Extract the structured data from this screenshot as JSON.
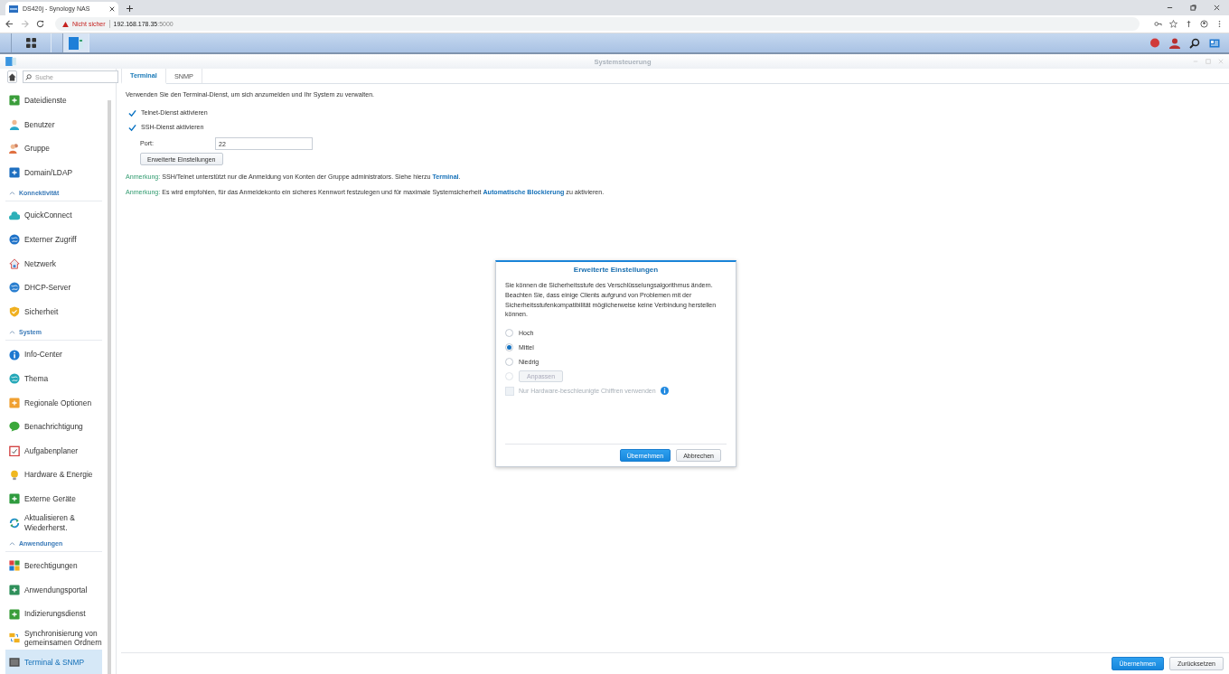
{
  "browser": {
    "tab_title": "DS420j - Synology NAS",
    "security_label": "Nicht sicher",
    "url_host": "192.168.178.35",
    "url_port": ":5000"
  },
  "window": {
    "title": "Systemsteuerung"
  },
  "sidebar": {
    "search": {
      "placeholder": "Suche"
    },
    "groups": [
      {
        "items": [
          {
            "label": "Dateidienste",
            "selected": false
          },
          {
            "label": "Benutzer",
            "selected": false
          },
          {
            "label": "Gruppe",
            "selected": false
          },
          {
            "label": "Domain/LDAP",
            "selected": false
          }
        ]
      },
      {
        "header": "Konnektivität",
        "expanded": true,
        "items": [
          {
            "label": "QuickConnect",
            "selected": false
          },
          {
            "label": "Externer Zugriff",
            "selected": false
          },
          {
            "label": "Netzwerk",
            "selected": false
          },
          {
            "label": "DHCP-Server",
            "selected": false
          },
          {
            "label": "Sicherheit",
            "selected": false
          }
        ]
      },
      {
        "header": "System",
        "expanded": true,
        "items": [
          {
            "label": "Info-Center",
            "selected": false
          },
          {
            "label": "Thema",
            "selected": false
          },
          {
            "label": "Regionale Optionen",
            "selected": false
          },
          {
            "label": "Benachrichtigung",
            "selected": false
          },
          {
            "label": "Aufgabenplaner",
            "selected": false
          },
          {
            "label": "Hardware & Energie",
            "selected": false
          },
          {
            "label": "Externe Geräte",
            "selected": false
          },
          {
            "label": "Aktualisieren & Wiederherst.",
            "selected": false
          }
        ]
      },
      {
        "header": "Anwendungen",
        "expanded": true,
        "items": [
          {
            "label": "Berechtigungen",
            "selected": false
          },
          {
            "label": "Anwendungsportal",
            "selected": false
          },
          {
            "label": "Indizierungsdienst",
            "selected": false
          },
          {
            "label": "Synchronisierung von gemeinsamen Ordnern",
            "selected": false
          },
          {
            "label": "Terminal & SNMP",
            "selected": true
          }
        ]
      }
    ]
  },
  "tabs": [
    {
      "label": "Terminal",
      "selected": true
    },
    {
      "label": "SNMP",
      "selected": false
    }
  ],
  "description": "Verwenden Sie den Terminal-Dienst, um sich anzumelden und Ihr System zu verwalten.",
  "checkboxes": [
    {
      "label": "Telnet-Dienst aktivieren",
      "checked": true
    },
    {
      "label": "SSH-Dienst aktivieren",
      "checked": true
    }
  ],
  "port": {
    "label": "Port:",
    "value": "22"
  },
  "advanced_button": "Erweiterte Einstellungen",
  "notes": [
    {
      "label": "Anmerkung:",
      "text": "SSH/Telnet unterstützt nur die Anmeldung von Konten der Gruppe administrators. Siehe hierzu",
      "link": "Terminal",
      "after": "."
    },
    {
      "label": "Anmerkung:",
      "text": "Es wird empfohlen, für das Anmeldekonto ein sicheres Kennwort festzulegen und für maximale Systemsicherheit",
      "link": "Automatische Blockierung",
      "after": " zu aktivieren."
    }
  ],
  "footer_buttons": [
    {
      "label": "Übernehmen",
      "kind": "primary"
    },
    {
      "label": "Zurücksetzen",
      "kind": "normal"
    }
  ],
  "dialog": {
    "title": "Erweiterte Einstellungen",
    "text": "Sie können die Sicherheitsstufe des Verschlüsselungsalgorithmus ändern. Beachten Sie, dass einige Clients aufgrund von Problemen mit der Sicherheitsstufenkompatibilität möglicherweise keine Verbindung herstellen können.",
    "options": [
      {
        "kind": "label",
        "label": "Hoch",
        "selected": false
      },
      {
        "kind": "label",
        "label": "Mittel",
        "selected": true
      },
      {
        "kind": "label",
        "label": "Niedrig",
        "selected": false
      },
      {
        "kind": "button",
        "label": "Anpassen",
        "selected": false,
        "disabled": true
      }
    ],
    "checkbox": {
      "label": "Nur Hardware-beschleunigte Chiffren verwenden",
      "checked": false,
      "disabled": true
    },
    "buttons": [
      {
        "label": "Übernehmen",
        "kind": "primary"
      },
      {
        "label": "Abbrechen",
        "kind": "normal"
      }
    ]
  }
}
